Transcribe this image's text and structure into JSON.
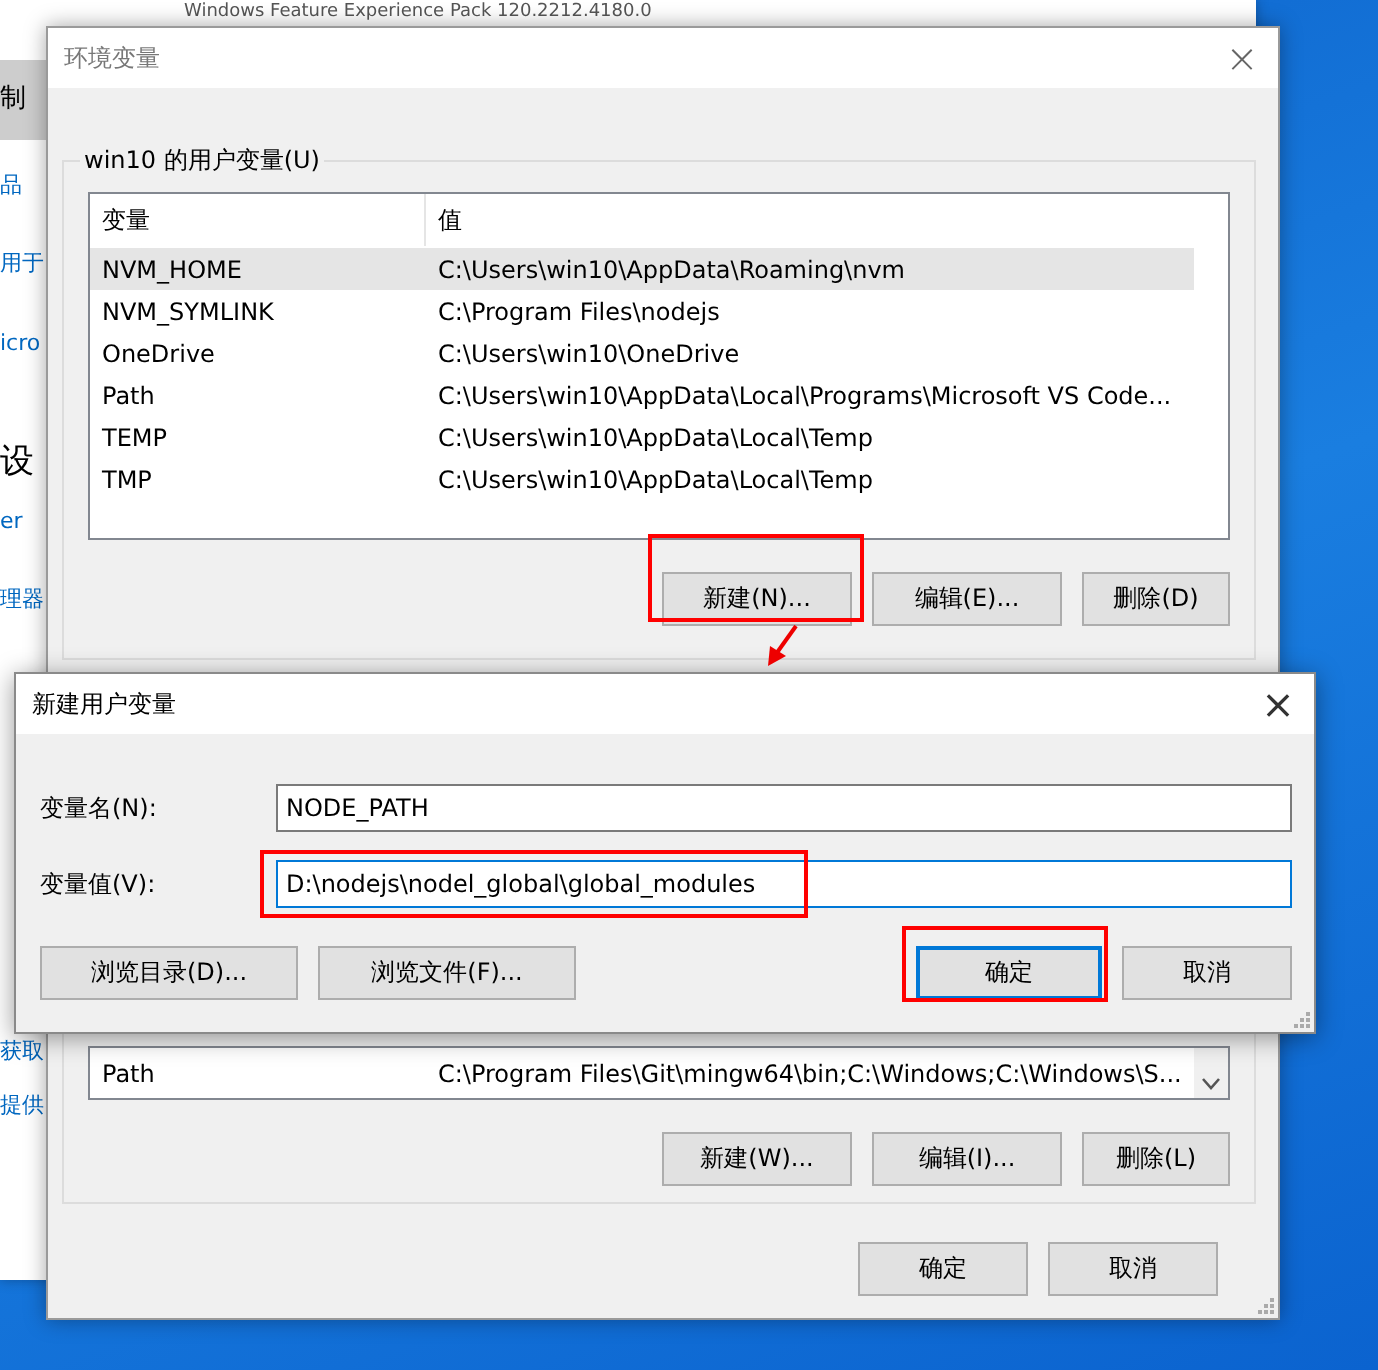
{
  "background_window": {
    "caption": "Windows Feature Experience Pack 120.2212.4180.0",
    "sidebar_items": [
      {
        "label": "制",
        "kind": "tab"
      },
      {
        "label": "品",
        "kind": "link"
      },
      {
        "label": "用于",
        "kind": "link"
      },
      {
        "label": "icro",
        "kind": "link"
      },
      {
        "label": "设",
        "kind": "heading"
      },
      {
        "label": "er",
        "kind": "link"
      },
      {
        "label": "理器",
        "kind": "link"
      },
      {
        "label": "获取",
        "kind": "link"
      },
      {
        "label": "提供",
        "kind": "link"
      }
    ]
  },
  "env_dialog": {
    "title": "环境变量",
    "close": "×",
    "user_variables": {
      "title": "win10 的用户变量(U)",
      "columns": [
        "变量",
        "值"
      ],
      "rows": [
        {
          "name": "NVM_HOME",
          "value": "C:\\Users\\win10\\AppData\\Roaming\\nvm",
          "selected": true
        },
        {
          "name": "NVM_SYMLINK",
          "value": "C:\\Program Files\\nodejs",
          "selected": false
        },
        {
          "name": "OneDrive",
          "value": "C:\\Users\\win10\\OneDrive",
          "selected": false
        },
        {
          "name": "Path",
          "value": "C:\\Users\\win10\\AppData\\Local\\Programs\\Microsoft VS Code...",
          "selected": false
        },
        {
          "name": "TEMP",
          "value": "C:\\Users\\win10\\AppData\\Local\\Temp",
          "selected": false
        },
        {
          "name": "TMP",
          "value": "C:\\Users\\win10\\AppData\\Local\\Temp",
          "selected": false
        }
      ],
      "buttons": [
        "新建(N)...",
        "编辑(E)...",
        "删除(D)"
      ]
    },
    "system_variables": {
      "rows": [
        {
          "name": "Path",
          "value": "C:\\Program Files\\Git\\mingw64\\bin;C:\\Windows;C:\\Windows\\S...",
          "selected": false
        }
      ],
      "buttons": [
        "新建(W)...",
        "编辑(I)...",
        "删除(L)"
      ]
    },
    "buttons": [
      "确定",
      "取消"
    ]
  },
  "new_variable_dialog": {
    "title": "新建用户变量",
    "close": "×",
    "fields": [
      {
        "label": "变量名(N):",
        "value": "NODE_PATH",
        "focused": false
      },
      {
        "label": "变量值(V):",
        "value": "D:\\nodejs\\nodel_global\\global_modules",
        "focused": true
      }
    ],
    "buttons": [
      {
        "label": "浏览目录(D)...",
        "focused": false
      },
      {
        "label": "浏览文件(F)...",
        "focused": false
      },
      {
        "label": "确定",
        "focused": true
      },
      {
        "label": "取消",
        "focused": false
      }
    ]
  },
  "annotations": [
    {
      "kind": "box"
    },
    {
      "kind": "box"
    },
    {
      "kind": "box"
    },
    {
      "kind": "arrow"
    }
  ]
}
